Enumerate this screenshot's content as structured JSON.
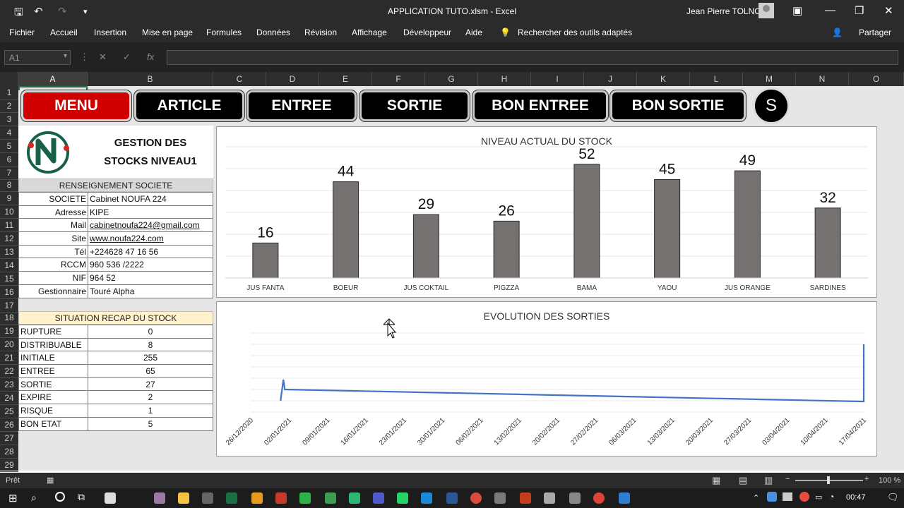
{
  "titlebar": {
    "title": "APPLICATION TUTO.xlsm  -  Excel",
    "user": "Jean Pierre TOLNO"
  },
  "ribbon_tabs": [
    "Fichier",
    "Accueil",
    "Insertion",
    "Mise en page",
    "Formules",
    "Données",
    "Révision",
    "Affichage",
    "Développeur",
    "Aide"
  ],
  "search_tools": "Rechercher des outils adaptés",
  "share_label": "Partager",
  "namebox": "A1",
  "fx_label": "fx",
  "columns": [
    "A",
    "B",
    "C",
    "D",
    "E",
    "F",
    "G",
    "H",
    "I",
    "J",
    "K",
    "L",
    "M",
    "N",
    "O"
  ],
  "rows": [
    "1",
    "2",
    "3",
    "4",
    "5",
    "6",
    "7",
    "8",
    "9",
    "10",
    "11",
    "12",
    "13",
    "14",
    "15",
    "16",
    "17",
    "18",
    "19",
    "20",
    "21",
    "22",
    "23",
    "24",
    "25",
    "26",
    "27",
    "28",
    "29"
  ],
  "nav": {
    "menu": "MENU",
    "article": "ARTICLE",
    "entree": "ENTREE",
    "sortie": "SORTIE",
    "bon_entree": "BON ENTREE",
    "bon_sortie": "BON SORTIE",
    "s": "S"
  },
  "company": {
    "title_line1": "GESTION DES",
    "title_line2": "STOCKS NIVEAU1",
    "section_header": "RENSEIGNEMENT SOCIETE",
    "fields": [
      {
        "label": "SOCIETE",
        "value": "Cabinet NOUFA 224"
      },
      {
        "label": "Adresse",
        "value": "KIPE"
      },
      {
        "label": "Mail",
        "value": "cabinetnoufa224@gmail.com"
      },
      {
        "label": "Site",
        "value": "www.noufa224.com"
      },
      {
        "label": "Tél",
        "value": "+224628 47 16 56"
      },
      {
        "label": "RCCM",
        "value": "960 536 /2222"
      },
      {
        "label": "NIF",
        "value": "964 52"
      },
      {
        "label": "Gestionnaire",
        "value": "Touré Alpha"
      }
    ]
  },
  "recap": {
    "header": "SITUATION RECAP DU STOCK",
    "rows": [
      {
        "label": "RUPTURE",
        "value": "0"
      },
      {
        "label": "DISTRIBUABLE",
        "value": "8"
      },
      {
        "label": "INITIALE",
        "value": "255"
      },
      {
        "label": "ENTREE",
        "value": "65"
      },
      {
        "label": "SORTIE",
        "value": "27"
      },
      {
        "label": "EXPIRE",
        "value": "2"
      },
      {
        "label": "RISQUE",
        "value": "1"
      },
      {
        "label": "BON ETAT",
        "value": "5"
      }
    ]
  },
  "chart_data": [
    {
      "type": "bar",
      "title": "NIVEAU ACTUAL DU STOCK",
      "categories": [
        "JUS FANTA",
        "BOEUR",
        "JUS COKTAIL",
        "PIGZZA",
        "BAMA",
        "YAOU",
        "JUS ORANGE",
        "SARDINES"
      ],
      "values": [
        16,
        44,
        29,
        26,
        52,
        45,
        49,
        32
      ],
      "ylim": [
        0,
        60
      ],
      "grid": true,
      "color": "#767171"
    },
    {
      "type": "line",
      "title": "EVOLUTION DES SORTIES",
      "x": [
        "26/12/2020",
        "02/01/2021",
        "09/01/2021",
        "16/01/2021",
        "23/01/2021",
        "30/01/2021",
        "06/02/2021",
        "13/02/2021",
        "20/02/2021",
        "27/02/2021",
        "06/03/2021",
        "13/03/2021",
        "20/03/2021",
        "27/03/2021",
        "03/04/2021",
        "10/04/2021",
        "17/04/2021"
      ],
      "grid": true,
      "color": "#4472c4"
    }
  ],
  "status": {
    "ready": "Prêt",
    "zoom": "100 %",
    "time": "00:47"
  },
  "colors": {
    "menu_red": "#d00000",
    "button_black": "#000000",
    "recap_header": "#fff2cc",
    "section_header": "#d9d9d9"
  }
}
